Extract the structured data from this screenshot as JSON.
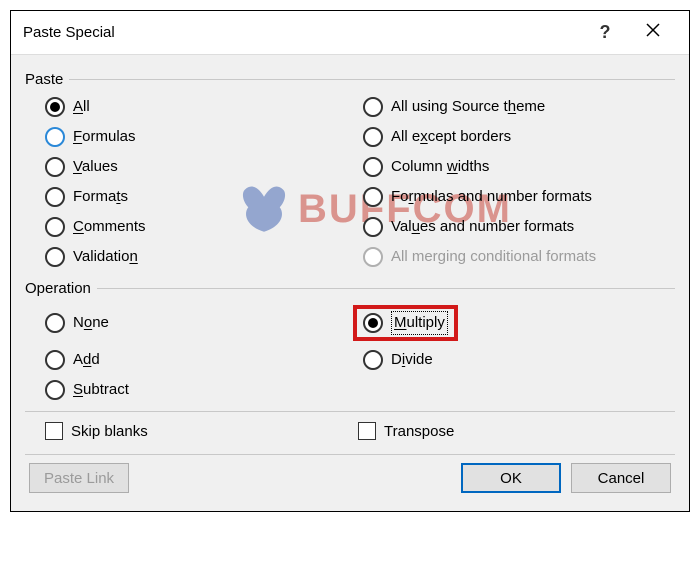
{
  "title": "Paste Special",
  "groups": {
    "paste": {
      "label": "Paste",
      "options": {
        "all": "All",
        "formulas": "Formulas",
        "values": "Values",
        "formats": "Formats",
        "comments": "Comments",
        "validation": "Validation",
        "theme": "All using Source theme",
        "except_borders": "All except borders",
        "col_widths": "Column widths",
        "form_num": "Formulas and number formats",
        "val_num": "Values and number formats",
        "cond": "All merging conditional formats"
      }
    },
    "operation": {
      "label": "Operation",
      "options": {
        "none": "None",
        "add": "Add",
        "subtract": "Subtract",
        "multiply": "Multiply",
        "divide": "Divide"
      }
    }
  },
  "checks": {
    "skip_blanks": "Skip blanks",
    "transpose": "Transpose"
  },
  "buttons": {
    "paste_link": "Paste Link",
    "ok": "OK",
    "cancel": "Cancel"
  },
  "state": {
    "paste_selected": "all",
    "paste_focused": "formulas",
    "cond_disabled": true,
    "operation_selected": "multiply",
    "skip_blanks": false,
    "transpose": false,
    "paste_link_enabled": false
  },
  "watermark": "BUFFCOM"
}
